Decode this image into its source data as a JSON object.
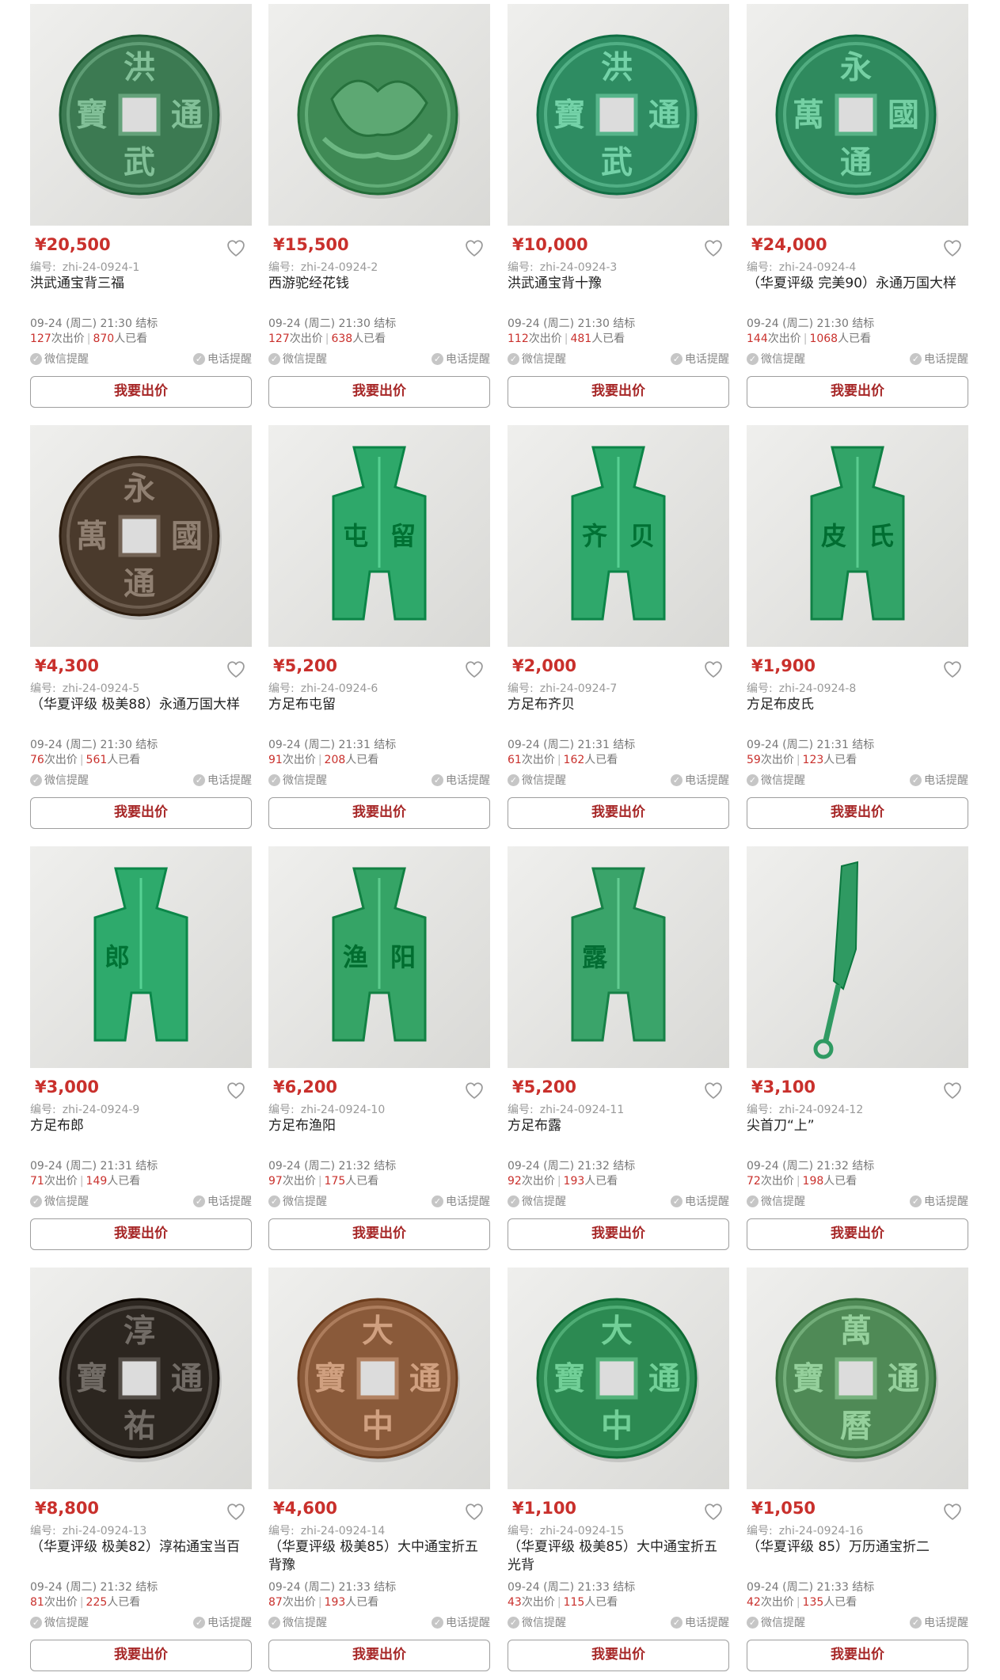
{
  "ui": {
    "accent_color": "#c9302c",
    "button_text_color": "#a62626",
    "code_label": "编号:",
    "bid_label": "我要出价",
    "wechat_remind": "微信提醒",
    "phone_remind": "电话提醒",
    "bids_suffix": "次出价",
    "views_suffix": "人已看",
    "favorite_icon": "heart-outline-icon",
    "check_icon": "check-circle-icon"
  },
  "lots": [
    {
      "price": "¥20,500",
      "code": "zhi-24-0924-1",
      "title": "洪武通宝背三福",
      "end_time": "09-24 (周二) 21:30 结标",
      "bids": "127",
      "views": "870",
      "image": {
        "kind": "round-coin",
        "color": "#3c7a52",
        "glyphs": [
          "洪",
          "通",
          "武",
          "寶"
        ]
      }
    },
    {
      "price": "¥15,500",
      "code": "zhi-24-0924-2",
      "title": "西游驼经花钱",
      "end_time": "09-24 (周二) 21:30 结标",
      "bids": "127",
      "views": "638",
      "image": {
        "kind": "charm-coin",
        "color": "#3f8a55",
        "glyphs": []
      }
    },
    {
      "price": "¥10,000",
      "code": "zhi-24-0924-3",
      "title": "洪武通宝背十豫",
      "end_time": "09-24 (周二) 21:30 结标",
      "bids": "112",
      "views": "481",
      "image": {
        "kind": "round-coin",
        "color": "#2e8c62",
        "glyphs": [
          "洪",
          "通",
          "武",
          "寶"
        ]
      }
    },
    {
      "price": "¥24,000",
      "code": "zhi-24-0924-4",
      "title": "（华夏评级 完美90）永通万国大样",
      "end_time": "09-24 (周二) 21:30 结标",
      "bids": "144",
      "views": "1068",
      "image": {
        "kind": "round-coin",
        "color": "#2f8a5e",
        "glyphs": [
          "永",
          "國",
          "通",
          "萬"
        ]
      }
    },
    {
      "price": "¥4,300",
      "code": "zhi-24-0924-5",
      "title": "（华夏评级 极美88）永通万国大样",
      "end_time": "09-24 (周二) 21:30 结标",
      "bids": "76",
      "views": "561",
      "image": {
        "kind": "round-coin",
        "color": "#4a3a2c",
        "glyphs": [
          "永",
          "國",
          "通",
          "萬"
        ]
      }
    },
    {
      "price": "¥5,200",
      "code": "zhi-24-0924-6",
      "title": "方足布屯留",
      "end_time": "09-24 (周二) 21:31 结标",
      "bids": "91",
      "views": "208",
      "image": {
        "kind": "spade",
        "color": "#2ea86a",
        "glyphs": [
          "屯",
          "留"
        ]
      }
    },
    {
      "price": "¥2,000",
      "code": "zhi-24-0924-7",
      "title": "方足布齐贝",
      "end_time": "09-24 (周二) 21:31 结标",
      "bids": "61",
      "views": "162",
      "image": {
        "kind": "spade",
        "color": "#2fa86b",
        "glyphs": [
          "齐",
          "贝"
        ]
      }
    },
    {
      "price": "¥1,900",
      "code": "zhi-24-0924-8",
      "title": "方足布皮氏",
      "end_time": "09-24 (周二) 21:31 结标",
      "bids": "59",
      "views": "123",
      "image": {
        "kind": "spade",
        "color": "#32a468",
        "glyphs": [
          "皮",
          "氏"
        ]
      }
    },
    {
      "price": "¥3,000",
      "code": "zhi-24-0924-9",
      "title": "方足布郎",
      "end_time": "09-24 (周二) 21:31 结标",
      "bids": "71",
      "views": "149",
      "image": {
        "kind": "spade",
        "color": "#2eaa6c",
        "glyphs": [
          "郎",
          ""
        ]
      }
    },
    {
      "price": "¥6,200",
      "code": "zhi-24-0924-10",
      "title": "方足布渔阳",
      "end_time": "09-24 (周二) 21:32 结标",
      "bids": "97",
      "views": "175",
      "image": {
        "kind": "spade",
        "color": "#35a466",
        "glyphs": [
          "渔",
          "阳"
        ]
      }
    },
    {
      "price": "¥5,200",
      "code": "zhi-24-0924-11",
      "title": "方足布露",
      "end_time": "09-24 (周二) 21:32 结标",
      "bids": "92",
      "views": "193",
      "image": {
        "kind": "spade",
        "color": "#3aa46a",
        "glyphs": [
          "露",
          ""
        ]
      }
    },
    {
      "price": "¥3,100",
      "code": "zhi-24-0924-12",
      "title": "尖首刀“上”",
      "end_time": "09-24 (周二) 21:32 结标",
      "bids": "72",
      "views": "198",
      "image": {
        "kind": "knife",
        "color": "#2f9a62",
        "glyphs": []
      }
    },
    {
      "price": "¥8,800",
      "code": "zhi-24-0924-13",
      "title": "（华夏评级 极美82）淳祐通宝当百",
      "end_time": "09-24 (周二) 21:32 结标",
      "bids": "81",
      "views": "225",
      "image": {
        "kind": "round-coin",
        "color": "#2c2620",
        "glyphs": [
          "淳",
          "通",
          "祐",
          "寶"
        ]
      }
    },
    {
      "price": "¥4,600",
      "code": "zhi-24-0924-14",
      "title": "（华夏评级 极美85）大中通宝折五背豫",
      "end_time": "09-24 (周二) 21:33 结标",
      "bids": "87",
      "views": "193",
      "image": {
        "kind": "round-coin",
        "color": "#8a5a3a",
        "glyphs": [
          "大",
          "通",
          "中",
          "寶"
        ]
      }
    },
    {
      "price": "¥1,100",
      "code": "zhi-24-0924-15",
      "title": "（华夏评级 极美85）大中通宝折五光背",
      "end_time": "09-24 (周二) 21:33 结标",
      "bids": "43",
      "views": "115",
      "image": {
        "kind": "round-coin",
        "color": "#2c8a52",
        "glyphs": [
          "大",
          "通",
          "中",
          "寶"
        ]
      }
    },
    {
      "price": "¥1,050",
      "code": "zhi-24-0924-16",
      "title": "（华夏评级 85）万历通宝折二",
      "end_time": "09-24 (周二) 21:33 结标",
      "bids": "42",
      "views": "135",
      "image": {
        "kind": "round-coin",
        "color": "#4f8a56",
        "glyphs": [
          "萬",
          "通",
          "曆",
          "寶"
        ]
      }
    }
  ]
}
